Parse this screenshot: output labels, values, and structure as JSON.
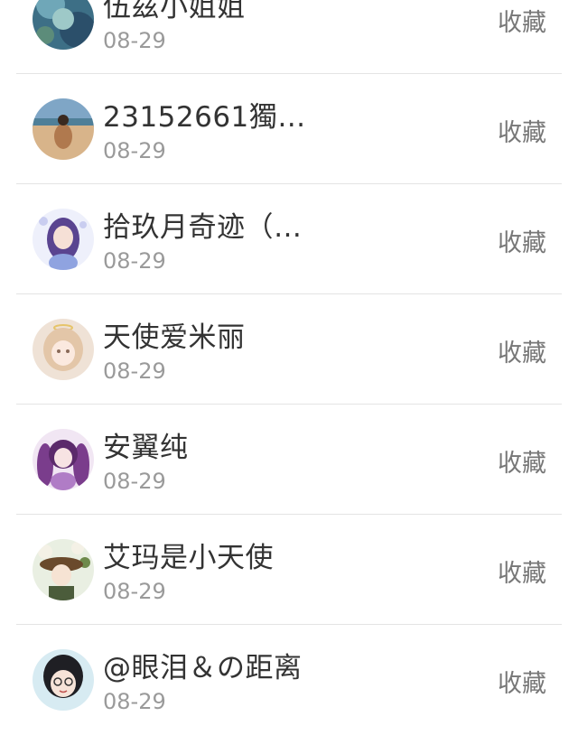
{
  "items": [
    {
      "name": "伍兹小姐姐",
      "date": "08-29",
      "action": "收藏",
      "avatar": "blue-fairy-avatar"
    },
    {
      "name": "23152661獨…",
      "date": "08-29",
      "action": "收藏",
      "avatar": "beach-person-avatar"
    },
    {
      "name": "拾玖月奇迹（…",
      "date": "08-29",
      "action": "收藏",
      "avatar": "purple-hair-girl-avatar"
    },
    {
      "name": "天使爱米丽",
      "date": "08-29",
      "action": "收藏",
      "avatar": "angel-girl-avatar"
    },
    {
      "name": "安翼纯",
      "date": "08-29",
      "action": "收藏",
      "avatar": "purple-twintail-girl-avatar"
    },
    {
      "name": "艾玛是小天使",
      "date": "08-29",
      "action": "收藏",
      "avatar": "flower-hat-girl-avatar"
    },
    {
      "name": "@眼泪＆の距离",
      "date": "08-29",
      "action": "收藏",
      "avatar": "glasses-girl-avatar"
    }
  ]
}
